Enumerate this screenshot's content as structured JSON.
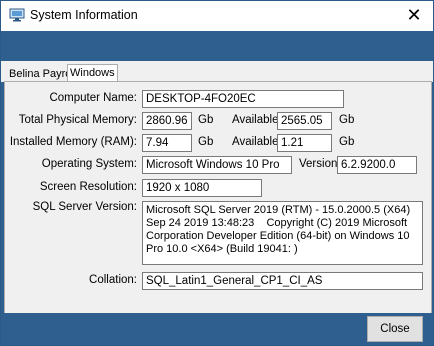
{
  "window": {
    "title": "System Information"
  },
  "tabs": [
    {
      "label": "Belina Payroll"
    },
    {
      "label": "Windows"
    }
  ],
  "fields": {
    "computer_name": {
      "label": "Computer Name:",
      "value": "DESKTOP-4FO20EC"
    },
    "total_physical_memory": {
      "label": "Total Physical Memory:",
      "value": "2860.96",
      "unit": "Gb"
    },
    "available_1": {
      "label": "Available:",
      "value": "2565.05",
      "unit": "Gb"
    },
    "installed_memory": {
      "label": "Installed Memory (RAM):",
      "value": "7.94",
      "unit": "Gb"
    },
    "available_2": {
      "label": "Available:",
      "value": "1.21",
      "unit": "Gb"
    },
    "operating_system": {
      "label": "Operating System:",
      "value": "Microsoft Windows 10 Pro"
    },
    "version": {
      "label": "Version:",
      "value": "6.2.9200.0"
    },
    "screen_resolution": {
      "label": "Screen Resolution:",
      "value": "1920 x 1080"
    },
    "sql_server_version": {
      "label": "SQL Server Version:",
      "value": "Microsoft SQL Server 2019 (RTM) - 15.0.2000.5 (X64)         Sep 24 2019 13:48:23    Copyright (C) 2019 Microsoft Corporation Developer Edition (64-bit) on Windows 10 Pro 10.0 <X64> (Build 19041: )"
    },
    "collation": {
      "label": "Collation:",
      "value": "SQL_Latin1_General_CP1_CI_AS"
    }
  },
  "buttons": {
    "close_label": "Close"
  },
  "colors": {
    "frame": "#2f5f8f",
    "panel": "#f0f0f0"
  }
}
